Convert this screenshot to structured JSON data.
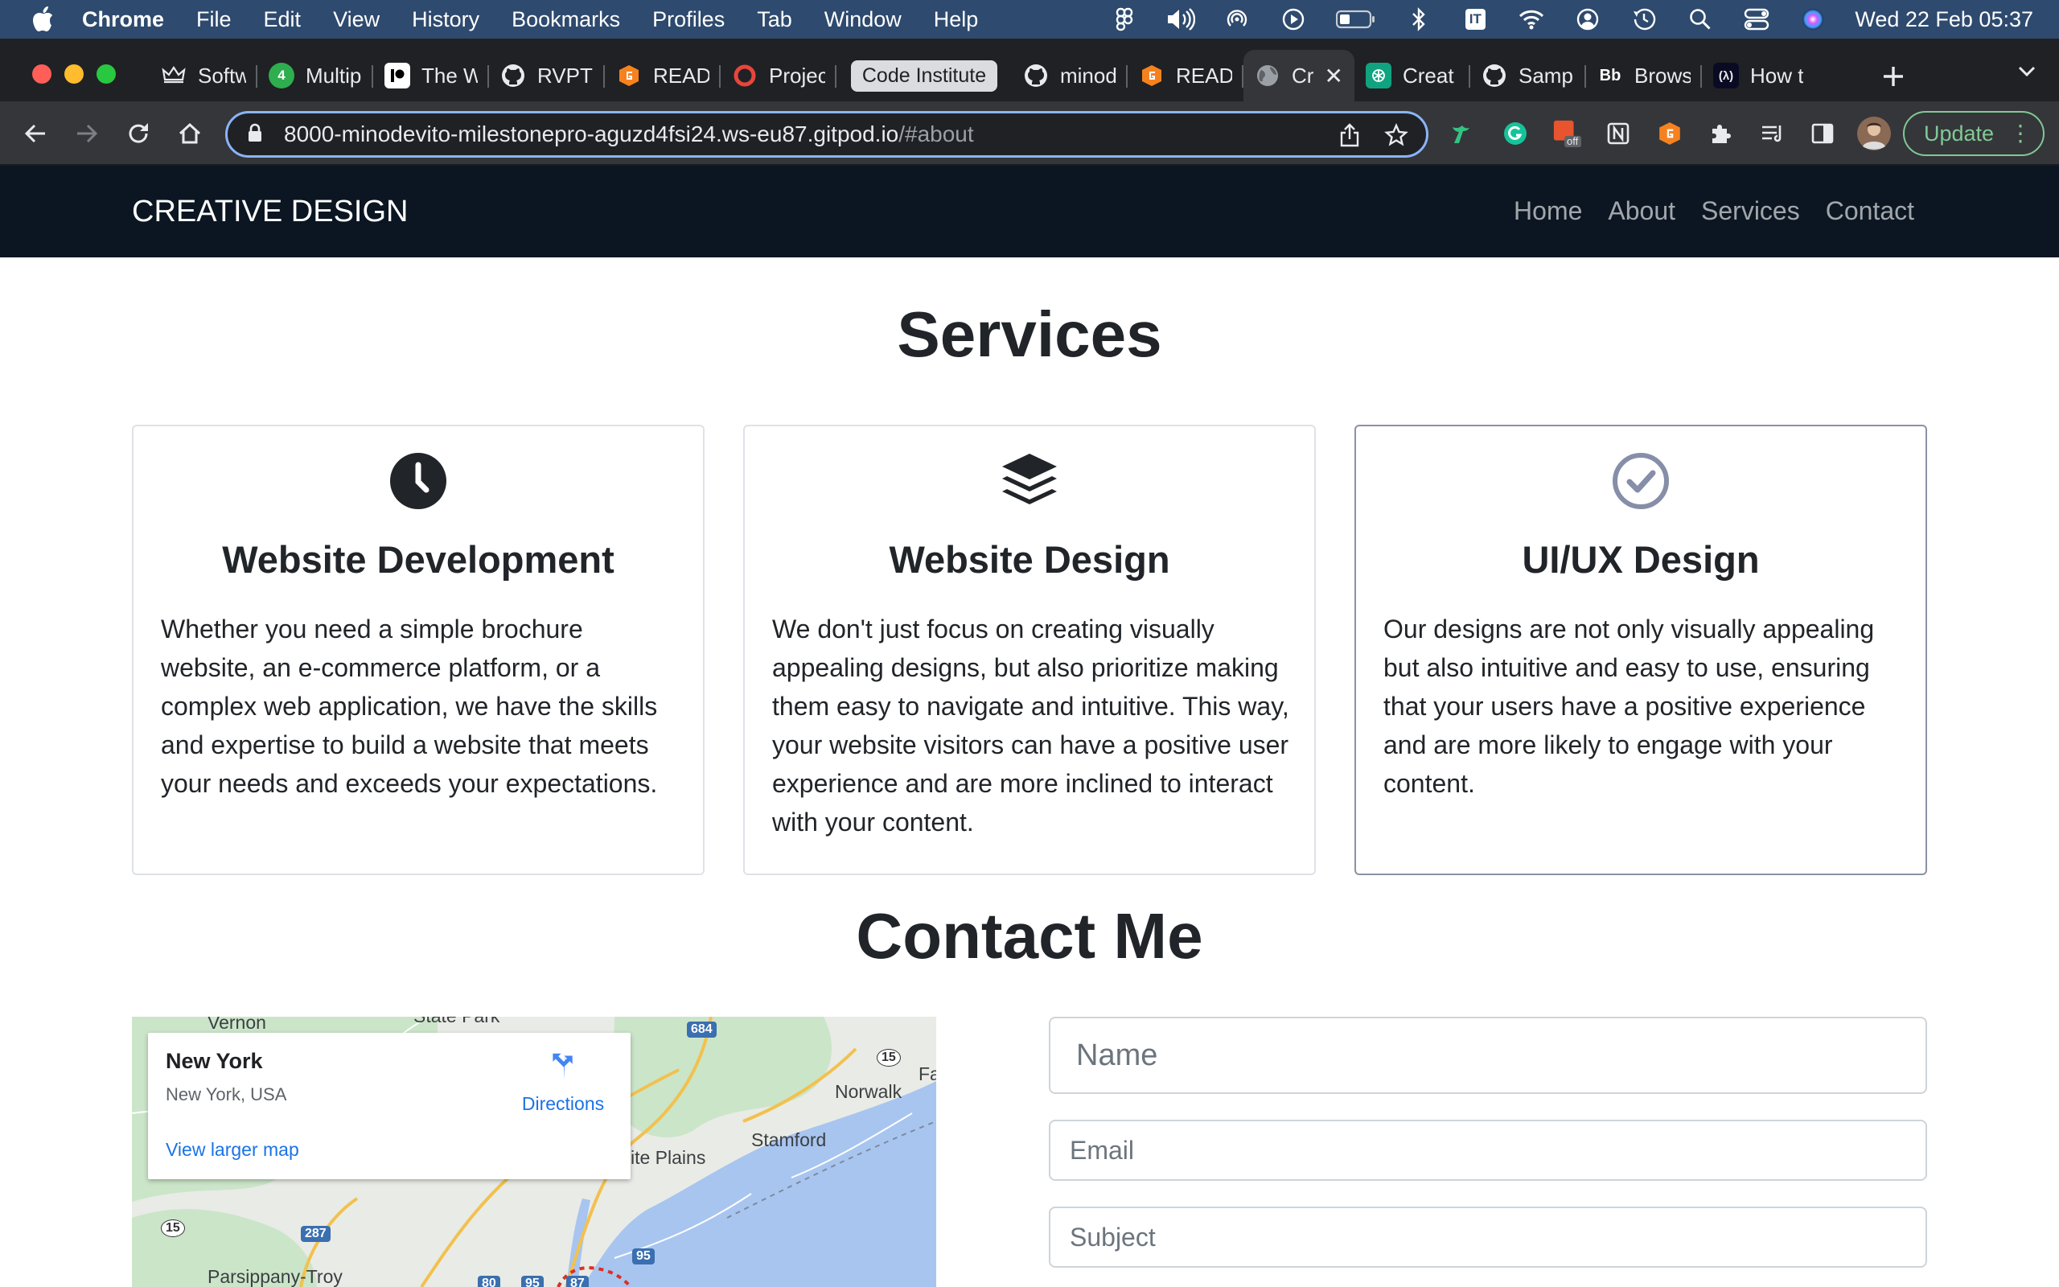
{
  "menubar": {
    "items": [
      "Chrome",
      "File",
      "Edit",
      "View",
      "History",
      "Bookmarks",
      "Profiles",
      "Tab",
      "Window",
      "Help"
    ],
    "status_icons": [
      "figma-icon",
      "volume-icon",
      "airdrop-icon",
      "play-icon",
      "battery-icon",
      "bluetooth-icon",
      "it-icon",
      "wifi-icon",
      "user-icon",
      "time-machine-icon",
      "spotlight-icon",
      "control-center-icon",
      "siri-icon"
    ],
    "it_label": "IT",
    "clock": "Wed 22 Feb  05:37"
  },
  "tabs": [
    {
      "title": "Softw",
      "icon": "crown-icon"
    },
    {
      "title": "Multip",
      "icon": "four-icon"
    },
    {
      "title": "The W",
      "icon": "patreon-icon"
    },
    {
      "title": "RVPT",
      "icon": "github-icon"
    },
    {
      "title": "READ",
      "icon": "g-orange-icon"
    },
    {
      "title": "Projec",
      "icon": "circle-red-icon"
    },
    {
      "title": "Code Institute",
      "icon": "group-label"
    },
    {
      "title": "minod",
      "icon": "github-icon"
    },
    {
      "title": "READ",
      "icon": "g-orange-icon"
    },
    {
      "title": "Cr",
      "icon": "globe-icon"
    },
    {
      "title": "Creat",
      "icon": "openai-icon"
    },
    {
      "title": "Samp",
      "icon": "github-icon"
    },
    {
      "title": "Brows",
      "icon": "bb-icon"
    },
    {
      "title": "How t",
      "icon": "fcc-icon"
    }
  ],
  "favicon_text": {
    "four": "4",
    "bb": "Bb",
    "fcc": "(λ)"
  },
  "toolbar": {
    "url_host": "8000-minodevito-milestonepro-aguzd4fsi24.ws-eu87.gitpod.io",
    "url_path": "/#about",
    "update_label": "Update",
    "ext_badge": "off"
  },
  "site": {
    "brand": "CREATIVE DESIGN",
    "nav": [
      "Home",
      "About",
      "Services",
      "Contact"
    ]
  },
  "services": {
    "heading": "Services",
    "cards": [
      {
        "icon": "clock-icon",
        "title": "Website Development",
        "text": "Whether you need a simple brochure website, an e-commerce platform, or a complex web application, we have the skills and expertise to build a website that meets your needs and exceeds your expectations."
      },
      {
        "icon": "layers-icon",
        "title": "Website Design",
        "text": "We don't just focus on creating visually appealing designs, but also prioritize making them easy to navigate and intuitive. This way, your website visitors can have a positive user experience and are more inclined to interact with your content."
      },
      {
        "icon": "check-circle-icon",
        "title": "UI/UX Design",
        "text": "Our designs are not only visually appealing but also intuitive and easy to use, ensuring that your users have a positive experience and are more likely to engage with your content."
      }
    ]
  },
  "contact": {
    "heading": "Contact Me",
    "map": {
      "place": "New York",
      "address": "New York, USA",
      "directions": "Directions",
      "larger_map": "View larger map",
      "labels": [
        "Vernon",
        "State Park",
        "Norwalk",
        "Stamford",
        "ite Plains",
        "Parsippany-Troy",
        "Fa"
      ],
      "shields": [
        "684",
        "15",
        "15",
        "287",
        "95",
        "80",
        "95",
        "87"
      ]
    },
    "fields": {
      "name": "Name",
      "email": "Email",
      "subject": "Subject"
    }
  },
  "colors": {
    "menubar": "#2e4a6e",
    "site_nav": "#0b1622",
    "accent_blue": "#8ab4f8",
    "update_green": "#81c995"
  }
}
